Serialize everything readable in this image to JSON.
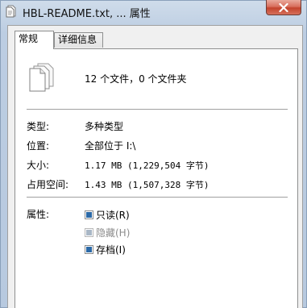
{
  "window": {
    "title": "HBL-README.txt, ... 属性"
  },
  "tabs": [
    {
      "label": "常规"
    },
    {
      "label": "详细信息"
    }
  ],
  "summary": "12 个文件，0 个文件夹",
  "rows": {
    "type": {
      "label": "类型:",
      "value": "多种类型"
    },
    "location": {
      "label": "位置:",
      "value": "全部位于 I:\\"
    },
    "size": {
      "label": "大小:",
      "value": "1.17 MB (1,229,504 字节)"
    },
    "size_on_disk": {
      "label": "占用空间:",
      "value": "1.43 MB (1,507,328 字节)"
    }
  },
  "attributes": {
    "label": "属性:",
    "read_only": {
      "label": "只读(R)",
      "checked": true
    },
    "hidden": {
      "label": "隐藏(H)",
      "checked": true,
      "disabled": true
    },
    "archive": {
      "label": "存档(I)",
      "checked": true
    }
  },
  "icons": {
    "title": "file-properties-icon",
    "files": "multiple-files-icon",
    "close": "close-icon"
  },
  "colors": {
    "close_button": "#c3432c",
    "checkbox_fill": "#2c6aa8",
    "frame": "#bccde2"
  }
}
